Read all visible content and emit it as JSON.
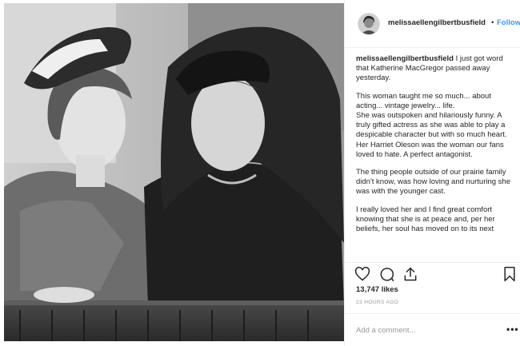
{
  "header": {
    "username": "melissaellengilbertbusfield",
    "separator": "•",
    "follow_label": "Follow"
  },
  "caption": {
    "username": "melissaellengilbertbusfield",
    "lead": "I just got word that Katherine MacGregor passed away yesterday.",
    "paragraphs": [
      "This woman taught me so much... about acting... vintage jewelry... life.\nShe was outspoken and hilariously funny. A truly gifted actress as she was able to play a despicable character but with so much heart. Her Harriet Oleson was the woman our fans loved to hate. A perfect antagonist.",
      "The thing people outside of our prairie family didn't know, was how loving and nurturing she was with the younger cast.",
      "I really loved her and I find great comfort knowing that she is at peace and, per her beliefs, her soul has moved on to its next"
    ]
  },
  "actions": {
    "icons": [
      "heart-icon",
      "comment-icon",
      "share-icon",
      "bookmark-icon"
    ]
  },
  "likes": "13,747 likes",
  "timestamp": "23 HOURS AGO",
  "comment": {
    "placeholder": "Add a comment...",
    "more_icon": "more-options-icon"
  },
  "photo": {
    "description_icon": "photo",
    "tone": "#3a3a3a"
  }
}
